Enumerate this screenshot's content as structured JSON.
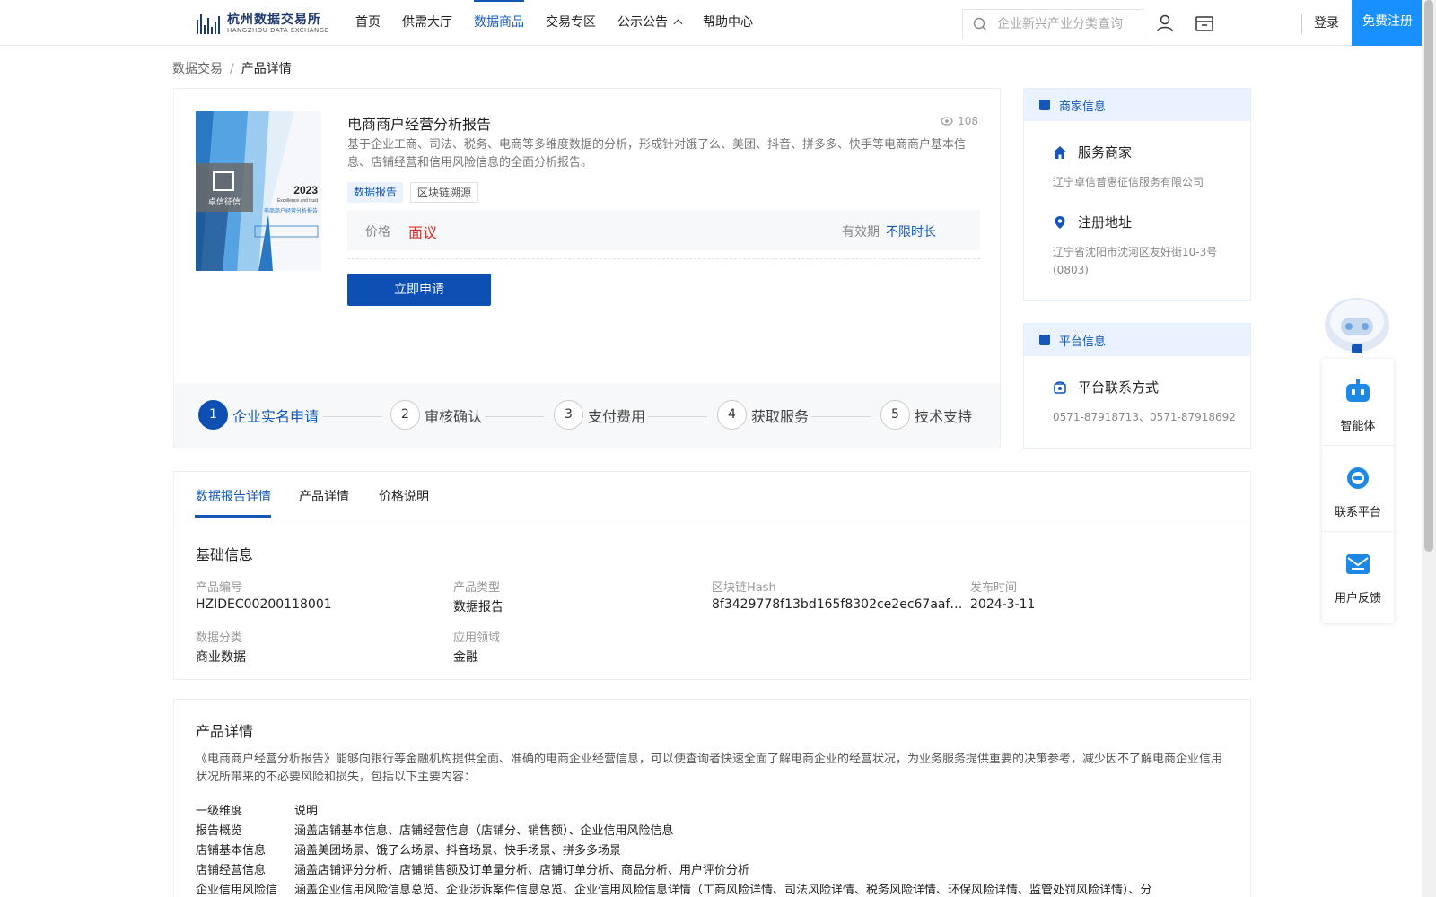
{
  "header": {
    "logo_cn": "杭州数据交易所",
    "logo_en": "HANGZHOU DATA EXCHANGE",
    "nav": [
      {
        "label": "首页"
      },
      {
        "label": "供需大厅"
      },
      {
        "label": "数据商品",
        "active": true
      },
      {
        "label": "交易专区"
      },
      {
        "label": "公示公告",
        "dropdown": true
      },
      {
        "label": "帮助中心"
      }
    ],
    "search_placeholder": "企业新兴产业分类查询",
    "login": "登录",
    "register": "免费注册"
  },
  "breadcrumb": {
    "root": "数据交易",
    "sep": "/",
    "current": "产品详情"
  },
  "product": {
    "title": "电商商户经营分析报告",
    "views": "108",
    "description": "基于企业工商、司法、税务、电商等多维度数据的分析，形成针对饿了么、美团、抖音、拼多多、快手等电商商户基本信息、店铺经营和信用风险信息的全面分析报告。",
    "tags": [
      "数据报告",
      "区块链溯源"
    ],
    "price_label": "价格",
    "price_value": "面议",
    "validity_label": "有效期",
    "validity_value": "不限时长",
    "apply_button": "立即申请",
    "cover": {
      "year": "2023",
      "slogan": "Excellence and trust",
      "brand": "卓信征信",
      "title": "电商商户经营分析报告"
    }
  },
  "steps": [
    {
      "num": "1",
      "label": "企业实名申请",
      "active": true
    },
    {
      "num": "2",
      "label": "审核确认"
    },
    {
      "num": "3",
      "label": "支付费用"
    },
    {
      "num": "4",
      "label": "获取服务"
    },
    {
      "num": "5",
      "label": "技术支持"
    }
  ],
  "merchant_panel": {
    "title": "商家信息",
    "service_label": "服务商家",
    "service_value": "辽宁卓信普惠征信服务有限公司",
    "address_label": "注册地址",
    "address_value": "辽宁省沈阳市沈河区友好街10-3号(0803)"
  },
  "platform_panel": {
    "title": "平台信息",
    "contact_label": "平台联系方式",
    "contact_value": "0571-87918713、0571-87918692"
  },
  "float_menu": [
    {
      "label": "智能体",
      "icon": "robot-icon"
    },
    {
      "label": "联系平台",
      "icon": "headset-icon"
    },
    {
      "label": "用户反馈",
      "icon": "mail-icon"
    }
  ],
  "tabs": [
    "数据报告详情",
    "产品详情",
    "价格说明"
  ],
  "basic_info": {
    "title": "基础信息",
    "fields": [
      {
        "label": "产品编号",
        "value": "HZIDEC00200118001"
      },
      {
        "label": "产品类型",
        "value": "数据报告"
      },
      {
        "label": "区块链Hash",
        "value": "8f3429778f13bd165f8302ce2ec67aafa6bd…"
      },
      {
        "label": "发布时间",
        "value": "2024-3-11"
      },
      {
        "label": "数据分类",
        "value": "商业数据"
      },
      {
        "label": "应用领域",
        "value": "金融"
      }
    ]
  },
  "product_detail": {
    "title": "产品详情",
    "text": "《电商商户经营分析报告》能够向银行等金融机构提供全面、准确的电商企业经营信息，可以使查询者快速全面了解电商企业的经营状况，为业务服务提供重要的决策参考，减少因不了解电商企业信用状况所带来的不必要风险和损失，包括以下主要内容：",
    "table": [
      {
        "a": "一级维度",
        "b": "说明"
      },
      {
        "a": "报告概览",
        "b": "涵盖店铺基本信息、店铺经营信息（店铺分、销售额）、企业信用风险信息"
      },
      {
        "a": "店铺基本信息",
        "b": "涵盖美团场景、饿了么场景、抖音场景、快手场景、拼多多场景"
      },
      {
        "a": "店铺经营信息",
        "b": "涵盖店铺评分分析、店铺销售额及订单量分析、店铺订单分析、商品分析、用户评价分析"
      },
      {
        "a": "企业信用风险信",
        "b": "涵盖企业信用风险信息总览、企业涉诉案件信息总览、企业信用风险信息详情（工商风险详情、司法风险详情、税务风险详情、环保风险详情、监管处罚风险详情）、分"
      }
    ]
  }
}
